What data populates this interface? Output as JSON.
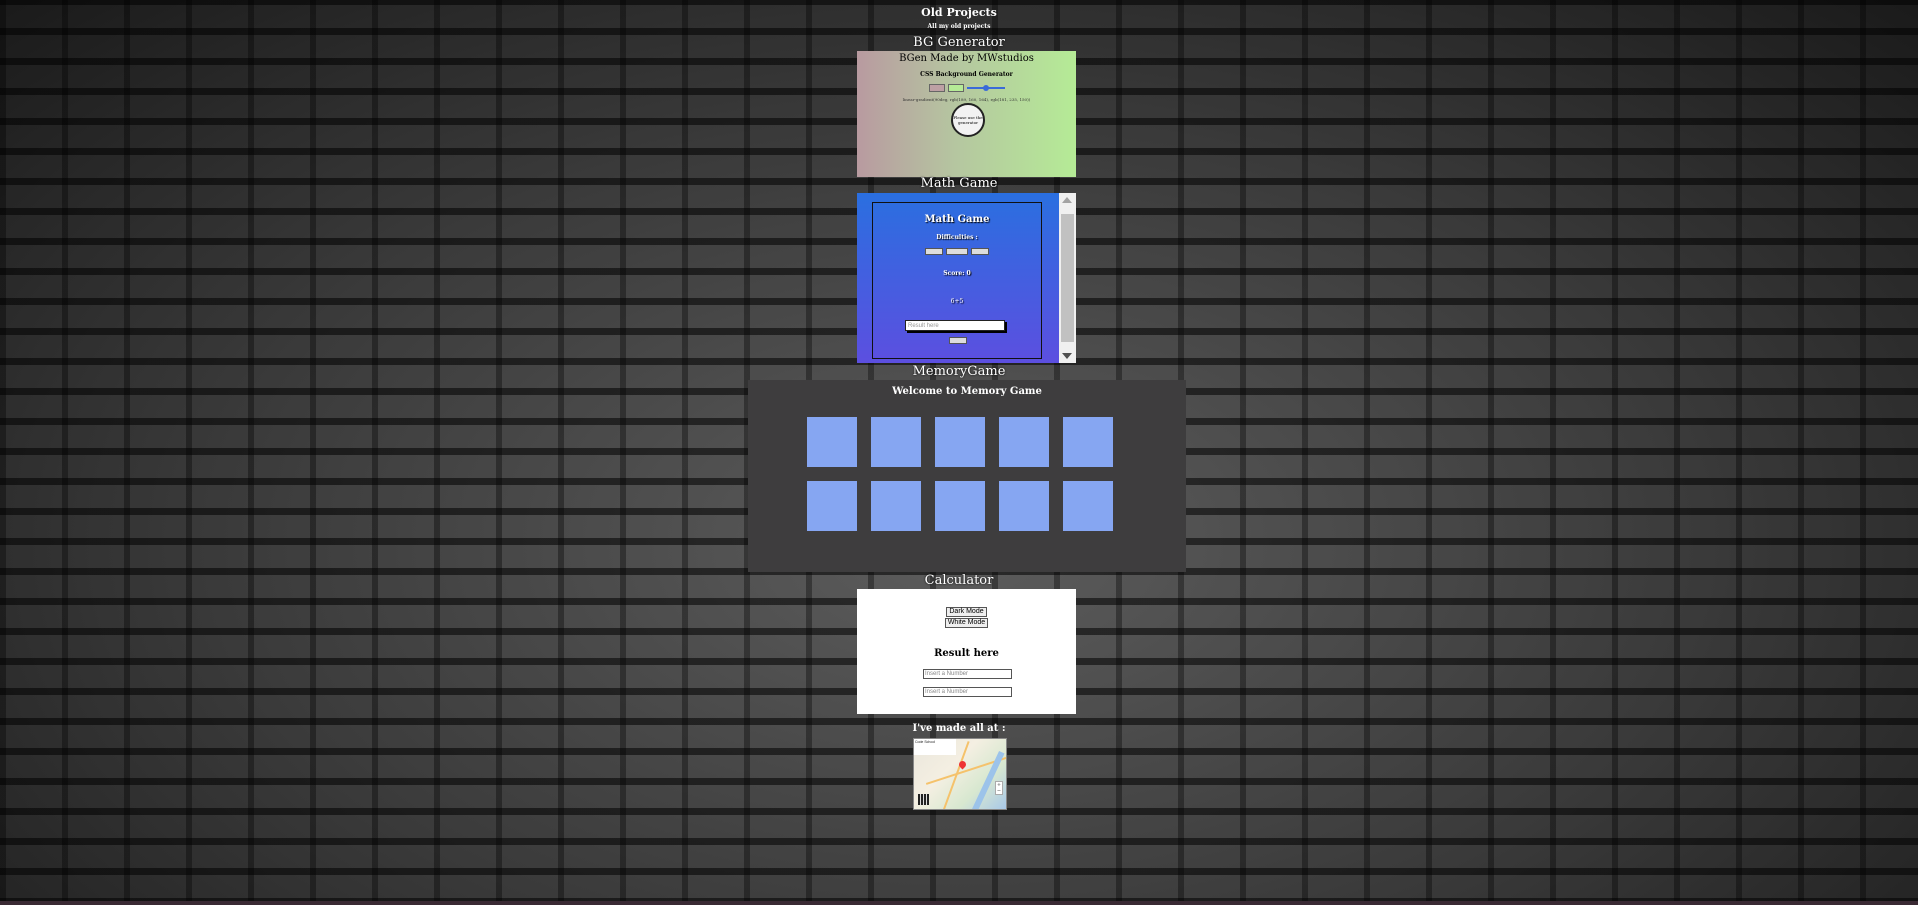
{
  "page": {
    "title": "Old Projects",
    "subtitle": "All my old projects"
  },
  "sections": {
    "bg_generator": "BG Generator",
    "math_game": "Math Game",
    "memory_game": "MemoryGame",
    "calculator": "Calculator"
  },
  "bg_generator": {
    "heading": "BGen Made by MWstudios",
    "subheading": "CSS Background Generator",
    "readout": "linear-gradient(90deg, rgb(189, 160, 164), rgb(181, 235, 150))",
    "circle_text": "Please use the generator"
  },
  "math_game": {
    "title": "Math Game",
    "difficulty_label": "Difficulties :",
    "score_label": "Score: 0",
    "question": "6+5",
    "input_placeholder": "Result here"
  },
  "memory_game": {
    "welcome": "Welcome to Memory Game",
    "card_color": "#86a6f2",
    "cards": 10
  },
  "calculator": {
    "dark_mode_label": "Dark Mode",
    "white_mode_label": "White Mode",
    "result_label": "Result here",
    "number_placeholder_1": "Insert a Number",
    "number_placeholder_2": "Insert a Number"
  },
  "footer": {
    "made_at_label": "I've made all at :",
    "map_place_label": "Code School"
  },
  "colors": {
    "memory_panel": "#3e3d3e",
    "math_gradient_top": "#2a6fe0",
    "math_gradient_bottom": "#5c4fe0"
  }
}
